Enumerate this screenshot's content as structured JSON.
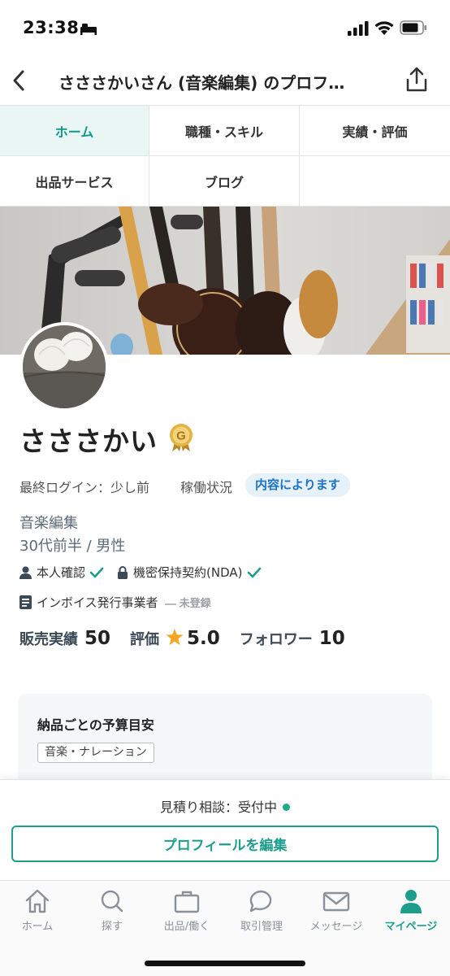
{
  "status_bar": {
    "time": "23:38"
  },
  "header": {
    "title": "さささかいさん (音楽編集) のプロフ…"
  },
  "tabs": [
    {
      "label": "ホーム",
      "active": true
    },
    {
      "label": "職種・スキル",
      "active": false
    },
    {
      "label": "実績・評価",
      "active": false
    },
    {
      "label": "出品サービス",
      "active": false
    },
    {
      "label": "ブログ",
      "active": false
    }
  ],
  "profile": {
    "name": "さささかい",
    "last_login_label": "最終ログイン：少し前",
    "work_status_label": "稼働状況",
    "work_status_value": "内容によります",
    "job_category": "音楽編集",
    "age_gender": "30代前半 / 男性",
    "identity_verified_label": "本人確認",
    "nda_label": "機密保持契約(NDA)",
    "invoice_label": "インボイス発行事業者",
    "invoice_status": "未登録"
  },
  "stats": {
    "sales_label": "販売実績",
    "sales_value": "50",
    "rating_label": "評価",
    "rating_value": "5.0",
    "followers_label": "フォロワー",
    "followers_value": "10"
  },
  "budget": {
    "title": "納品ごとの予算目安",
    "tag": "音楽・ナレーション"
  },
  "bottom_sheet": {
    "estimate_label": "見積り相談：受付中",
    "edit_button_label": "プロフィールを編集"
  },
  "bottom_nav": [
    {
      "label": "ホーム",
      "icon": "home-icon",
      "active": false
    },
    {
      "label": "探す",
      "icon": "search-icon",
      "active": false
    },
    {
      "label": "出品/働く",
      "icon": "briefcase-icon",
      "active": false
    },
    {
      "label": "取引管理",
      "icon": "chat-bubble-icon",
      "active": false
    },
    {
      "label": "メッセージ",
      "icon": "envelope-icon",
      "active": false
    },
    {
      "label": "マイページ",
      "icon": "person-icon",
      "active": true
    }
  ],
  "colors": {
    "accent": "#1d9e8c",
    "status_pill_bg": "#e6f1fa",
    "status_pill_text": "#1b73c4",
    "star": "#f5a623"
  }
}
